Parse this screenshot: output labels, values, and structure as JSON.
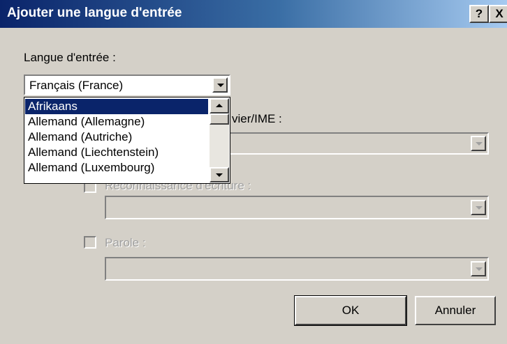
{
  "window": {
    "title": "Ajouter une langue d'entrée",
    "help_label": "?",
    "close_label": "X"
  },
  "input_language": {
    "label": "Langue d'entrée :",
    "selected": "Français (France)",
    "options": [
      "Afrikaans",
      "Allemand (Allemagne)",
      "Allemand (Autriche)",
      "Allemand (Liechtenstein)",
      "Allemand (Luxembourg)"
    ],
    "highlighted_index": 0
  },
  "keyboard_layout": {
    "label_visible_part": "vier/IME :"
  },
  "handwriting": {
    "label": "Reconnaissance d'écriture :",
    "checked": false
  },
  "speech": {
    "label": "Parole :",
    "checked": false
  },
  "buttons": {
    "ok": "OK",
    "cancel": "Annuler"
  }
}
